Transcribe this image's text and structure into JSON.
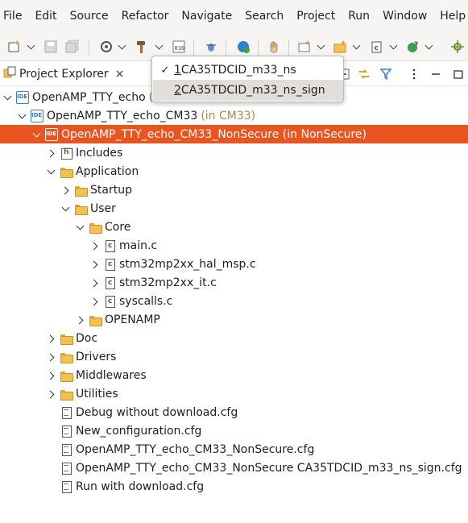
{
  "menubar": {
    "items": [
      "File",
      "Edit",
      "Source",
      "Refactor",
      "Navigate",
      "Search",
      "Project",
      "Run",
      "Window",
      "Help"
    ]
  },
  "toolbar": {
    "icons": [
      "new-icon",
      "save-icon",
      "save-all-icon",
      "settings-icon",
      "build-hammer-icon",
      "binary-icon",
      "debug-icon",
      "run-icon",
      "hand-icon",
      "new-project-icon",
      "new-folder-icon",
      "new-class-icon",
      "refresh-icon",
      "pin-icon"
    ]
  },
  "explorer": {
    "tab_label": "Project Explorer",
    "close_glyph": "×"
  },
  "tree": {
    "rows": [
      {
        "label": "OpenAMP_TTY_echo",
        "suffix": "(i"
      },
      {
        "label": "OpenAMP_TTY_echo_CM33",
        "suffix": "(in CM33)"
      },
      {
        "label": "OpenAMP_TTY_echo_CM33_NonSecure (in NonSecure)",
        "suffix": ""
      },
      {
        "label": "Includes",
        "suffix": ""
      },
      {
        "label": "Application",
        "suffix": ""
      },
      {
        "label": "Startup",
        "suffix": ""
      },
      {
        "label": "User",
        "suffix": ""
      },
      {
        "label": "Core",
        "suffix": ""
      },
      {
        "label": "main.c",
        "suffix": ""
      },
      {
        "label": "stm32mp2xx_hal_msp.c",
        "suffix": ""
      },
      {
        "label": "stm32mp2xx_it.c",
        "suffix": ""
      },
      {
        "label": "syscalls.c",
        "suffix": ""
      },
      {
        "label": "OPENAMP",
        "suffix": ""
      },
      {
        "label": "Doc",
        "suffix": ""
      },
      {
        "label": "Drivers",
        "suffix": ""
      },
      {
        "label": "Middlewares",
        "suffix": ""
      },
      {
        "label": "Utilities",
        "suffix": ""
      },
      {
        "label": "Debug without download.cfg",
        "suffix": ""
      },
      {
        "label": "New_configuration.cfg",
        "suffix": ""
      },
      {
        "label": "OpenAMP_TTY_echo_CM33_NonSecure.cfg",
        "suffix": ""
      },
      {
        "label": "OpenAMP_TTY_echo_CM33_NonSecure CA35TDCID_m33_ns_sign.cfg",
        "suffix": ""
      },
      {
        "label": "Run with download.cfg",
        "suffix": ""
      }
    ]
  },
  "popup": {
    "items": [
      {
        "mnemonic": "1",
        "label": " CA35TDCID_m33_ns",
        "checked": "✓"
      },
      {
        "mnemonic": "2",
        "label": " CA35TDCID_m33_ns_sign",
        "checked": ""
      }
    ]
  },
  "colors": {
    "selection": "#e95420",
    "suffix": "#a68b4e",
    "chrome": "#f6f5f4"
  }
}
